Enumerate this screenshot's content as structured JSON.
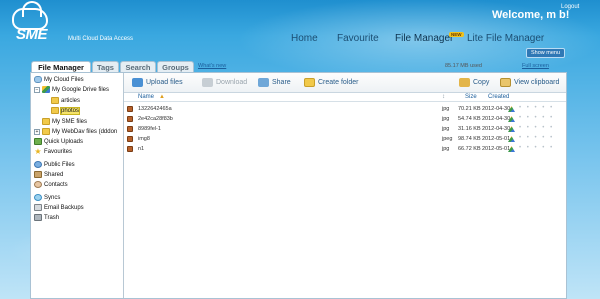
{
  "header": {
    "brand": "SME",
    "tagline": "Multi Cloud Data Access",
    "welcome": "Welcome, m b!",
    "logout": "Logout"
  },
  "nav": {
    "items": [
      "Home",
      "Favourite",
      "File Manager",
      "Lite File Manager"
    ],
    "new_badge": "NEW",
    "show_menu": "Show menu"
  },
  "tabs": {
    "items": [
      "File Manager",
      "Tags",
      "Search",
      "Groups"
    ],
    "whats_new": "What's new",
    "usage": "85.17 MB used",
    "full_screen": "Full screen"
  },
  "tree": {
    "my_cloud_files": "My Cloud Files",
    "google_drive": "My Google Drive files",
    "articles": "articles",
    "photos": "photos",
    "sme_files": "My SME files",
    "webdav": "My WebDav files (dddon",
    "quick_uploads": "Quick Uploads",
    "favourites": "Favourites",
    "public_files": "Public Files",
    "shared": "Shared",
    "contacts": "Contacts",
    "syncs": "Syncs",
    "email_backups": "Email Backups",
    "trash": "Trash"
  },
  "toolbar": {
    "upload": "Upload files",
    "download": "Download",
    "share": "Share",
    "create_folder": "Create folder",
    "copy": "Copy",
    "view_clipboard": "View clipboard"
  },
  "columns": {
    "name": "Name",
    "size": "Size",
    "created": "Created"
  },
  "files": [
    {
      "name": "1322642465a",
      "type": "jpg",
      "size": "70.21 KB",
      "created": "2012-04-30"
    },
    {
      "name": "2e42ca28f83b",
      "type": "jpg",
      "size": "54.74 KB",
      "created": "2012-04-30"
    },
    {
      "name": "8989fel-1",
      "type": "jpg",
      "size": "31.16 KB",
      "created": "2012-04-30"
    },
    {
      "name": "img8",
      "type": "jpeg",
      "size": "98.74 KB",
      "created": "2012-05-01"
    },
    {
      "name": "n1",
      "type": "jpg",
      "size": "66.72 KB",
      "created": "2012-05-01"
    }
  ],
  "colors": {
    "background": "#3aa8e0",
    "selected": "#f5e36a",
    "link": "#1b5e9c"
  }
}
